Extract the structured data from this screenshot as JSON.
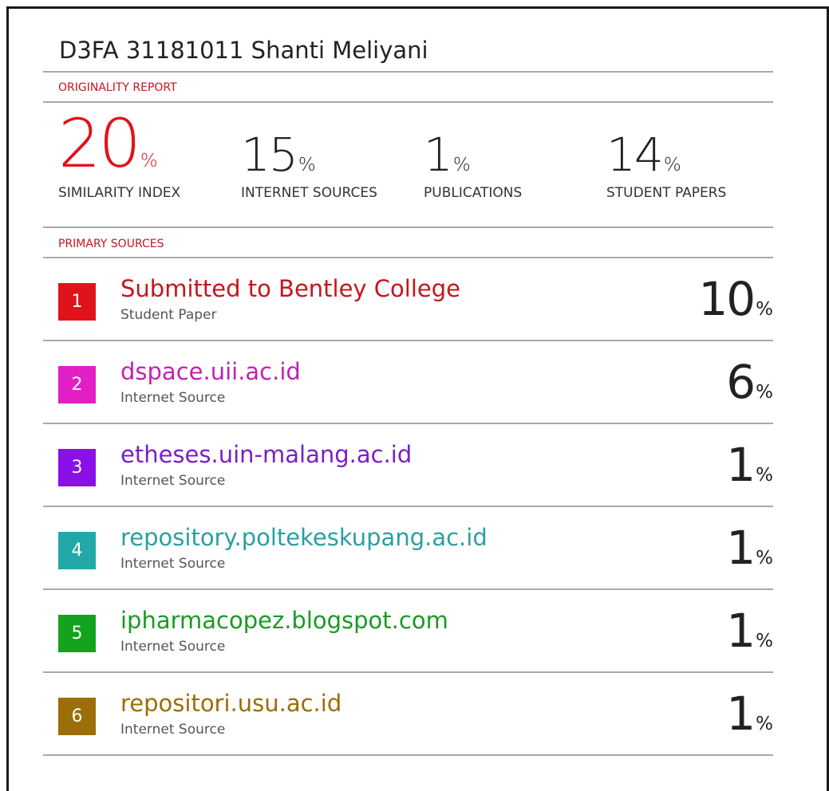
{
  "title": "D3FA 31181011 Shanti Meliyani",
  "originality_label": "ORIGINALITY REPORT",
  "primary_sources_label": "PRIMARY SOURCES",
  "percent_sign": "%",
  "stats": [
    {
      "value": "20",
      "label": "SIMILARITY INDEX",
      "color": "#e1131a"
    },
    {
      "value": "15",
      "label": "INTERNET SOURCES"
    },
    {
      "value": "1",
      "label": "PUBLICATIONS"
    },
    {
      "value": "14",
      "label": "STUDENT PAPERS"
    }
  ],
  "sources": [
    {
      "rank": "1",
      "name": "Submitted to Bentley College",
      "type": "Student Paper",
      "percent": "10",
      "color": "#e1131a",
      "text_color": "#c4161c"
    },
    {
      "rank": "2",
      "name": "dspace.uii.ac.id",
      "type": "Internet Source",
      "percent": "6",
      "color": "#e21fc4",
      "text_color": "#c51fb0"
    },
    {
      "rank": "3",
      "name": "etheses.uin-malang.ac.id",
      "type": "Internet Source",
      "percent": "1",
      "color": "#8a10e8",
      "text_color": "#7a1ec9"
    },
    {
      "rank": "4",
      "name": "repository.poltekeskupang.ac.id",
      "type": "Internet Source",
      "percent": "1",
      "color": "#22a8a8",
      "text_color": "#2a9fa3"
    },
    {
      "rank": "5",
      "name": "ipharmacopez.blogspot.com",
      "type": "Internet Source",
      "percent": "1",
      "color": "#13a31f",
      "text_color": "#1a9a24"
    },
    {
      "rank": "6",
      "name": "repositori.usu.ac.id",
      "type": "Internet Source",
      "percent": "1",
      "color": "#9b6e07",
      "text_color": "#9b6e07"
    }
  ]
}
